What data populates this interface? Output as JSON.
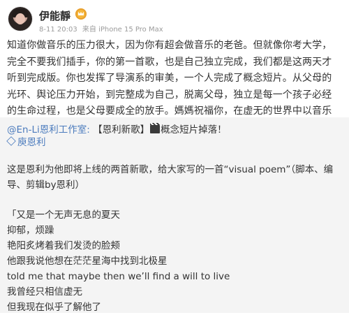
{
  "user": {
    "name": "伊能靜",
    "meta_date": "8-11 20:03",
    "meta_source": "来自 iPhone 15 Pro Max"
  },
  "post": {
    "text": "知道你做音乐的压力很大，因为你有超会做音乐的老爸。但就像你考大学，完全不要我们插手，你的第一首歌，也是自己独立完成，我们都是这两天才听到完成版。你也发挥了导演系的审美，一个人完成了概念短片。从父母的光环、舆论压力开始，到完整成为自己，脱离父母，独立是每一个孩子必经的生命过程，也是父母要成全的放手。媽媽祝福你，在虚无的世界中以音乐找到生命的意义。"
  },
  "repost": {
    "author_link": "@En-Li恩利工作室",
    "colon": ":",
    "title_text": "【恩利新歌】",
    "title_suffix": "概念短片掉落！",
    "tag_link": "庾恩利",
    "intro": "这是恩利为他即将上线的两首新歌，给大家写的一首“visual poem”（脚本、编导、剪辑by恩利）",
    "poem_lines": [
      "「又是一个无声无息的夏天",
      "抑郁，烦躁",
      "艳阳炙烤着我们发烫的脸颊",
      "他跟我说他想在茫茫星海中找到北极星",
      "told me that maybe then we’ll find a will to live",
      "我曾经只相信虚无",
      "但我现在似乎了解他了"
    ]
  },
  "colors": {
    "link": "#4b7bbd",
    "repost_bg": "#f4f4f4",
    "heart": "#e0333b",
    "vip": "#f6b73c"
  },
  "icons": [
    "vip-crown-icon",
    "heart-icon",
    "clapper-board-icon",
    "super-topic-diamond-icon"
  ]
}
